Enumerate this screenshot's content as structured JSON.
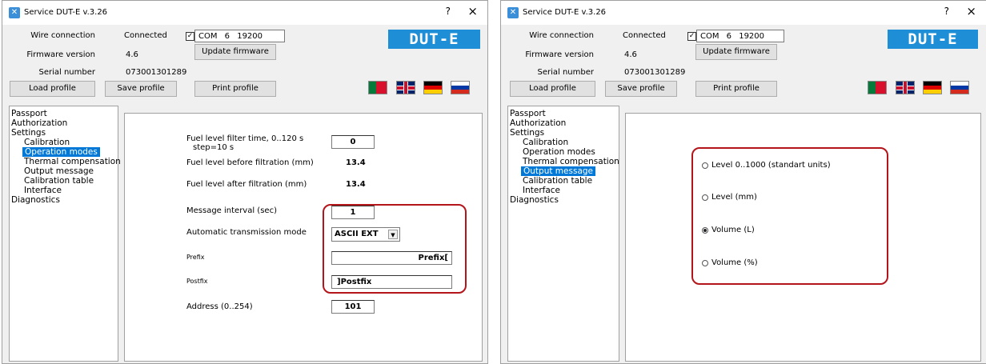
{
  "app": {
    "title": "Service DUT-E  v.3.26",
    "help": "?",
    "close": "×",
    "logo": "DUT-E"
  },
  "header": {
    "wire_label": "Wire connection",
    "wire_value": "Connected",
    "firmware_label": "Firmware version",
    "firmware_value": "4.6",
    "serial_label": "Serial number",
    "serial_value": "073001301289",
    "com_checked": "✓",
    "com_value": "COM 6 19200 bit/s",
    "update_btn": "Update firmware"
  },
  "toolbar": {
    "load": "Load profile",
    "save": "Save profile",
    "print": "Print profile"
  },
  "languages": [
    "Portuguese",
    "English",
    "German",
    "Russian"
  ],
  "tree": [
    "Passport",
    "Authorization",
    "Settings",
    "Calibration",
    "Operation modes",
    "Thermal compensation",
    "Output message",
    "Calibration table",
    "Interface",
    "Diagnostics"
  ],
  "left_window": {
    "selected_item": "Operation modes",
    "filter_label": "Fuel level filter time, 0..120 s",
    "filter_step": "step=10 s",
    "filter_value": "0",
    "before_label": "Fuel level before filtration (mm)",
    "before_value": "13.4",
    "after_label": "Fuel level after filtration (mm)",
    "after_value": "13.4",
    "interval_label": "Message interval (sec)",
    "interval_value": "1",
    "mode_label": "Automatic transmission mode",
    "mode_value": "ASCII EXT",
    "mode_arrow": "▼",
    "prefix_label": "Prefix",
    "prefix_value": "Prefix[",
    "postfix_label": "Postfix",
    "postfix_value": "]Postfix",
    "address_label": "Address (0..254)",
    "address_value": "101"
  },
  "right_window": {
    "selected_item": "Output message",
    "options": [
      "Level 0..1000 (standart units)",
      "Level (mm)",
      "Volume  (L)",
      "Volume (%)"
    ],
    "selected_option": "Volume  (L)"
  },
  "colors": {
    "selection": "#0078d7",
    "highlight": "#b3151b",
    "logo_bg": "#1e8fd6"
  }
}
